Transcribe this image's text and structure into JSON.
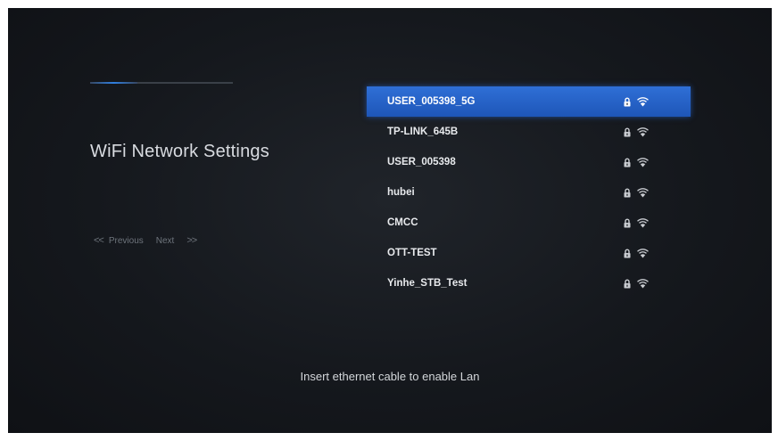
{
  "header": {
    "title": "WiFi Network Settings",
    "progress_fraction": 0.33
  },
  "pager": {
    "prev_chevron": "<<",
    "prev_label": "Previous",
    "next_label": "Next",
    "next_chevron": ">>"
  },
  "networks": [
    {
      "ssid": "USER_005398_5G",
      "secured": true,
      "signal_icon": "wifi-icon",
      "lock_icon": "lock-icon",
      "selected": true
    },
    {
      "ssid": "TP-LINK_645B",
      "secured": true,
      "signal_icon": "wifi-icon",
      "lock_icon": "lock-icon",
      "selected": false
    },
    {
      "ssid": "USER_005398",
      "secured": true,
      "signal_icon": "wifi-icon",
      "lock_icon": "lock-icon",
      "selected": false
    },
    {
      "ssid": "hubei",
      "secured": true,
      "signal_icon": "wifi-icon",
      "lock_icon": "lock-icon",
      "selected": false
    },
    {
      "ssid": "CMCC",
      "secured": true,
      "signal_icon": "wifi-icon",
      "lock_icon": "lock-icon",
      "selected": false
    },
    {
      "ssid": "OTT-TEST",
      "secured": true,
      "signal_icon": "wifi-icon",
      "lock_icon": "lock-icon",
      "selected": false
    },
    {
      "ssid": "Yinhe_STB_Test",
      "secured": true,
      "signal_icon": "wifi-icon",
      "lock_icon": "lock-icon",
      "selected": false
    }
  ],
  "footer": {
    "lan_hint": "Insert ethernet cable to enable Lan"
  },
  "colors": {
    "selected_row": "#2563c9",
    "background": "#16191e",
    "accent": "#2f7fe0"
  }
}
